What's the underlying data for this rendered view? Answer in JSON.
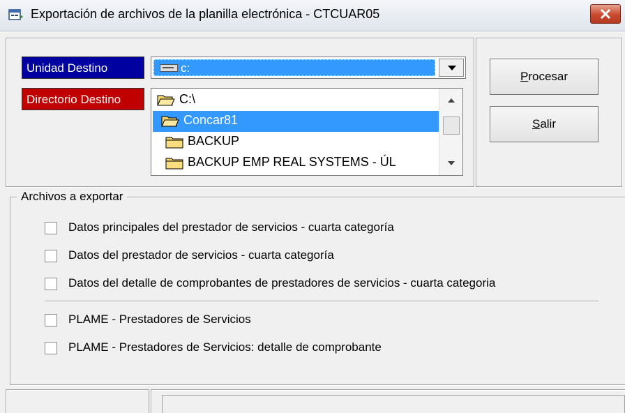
{
  "window": {
    "title": "Exportación de archivos de la planilla electrónica - CTCUAR05",
    "icons": {
      "app": "app-window-icon",
      "close": "close-icon"
    }
  },
  "destination": {
    "unit_label": "Unidad Destino",
    "unit_label_color": "#0000a0",
    "unit_value": "c:",
    "dir_label": "Directorio Destino",
    "dir_label_color": "#c00000",
    "directories": [
      {
        "name": "C:\\",
        "open": true,
        "selected": false
      },
      {
        "name": "Concar81",
        "open": true,
        "selected": true
      },
      {
        "name": "BACKUP",
        "open": false,
        "selected": false
      },
      {
        "name": "BACKUP EMP REAL SYSTEMS - ÚL",
        "open": false,
        "selected": false
      }
    ],
    "selection_color": "#3399ff"
  },
  "actions": {
    "process_label_prefix": "",
    "process_label_accel": "P",
    "process_label_rest": "rocesar",
    "exit_label_accel": "S",
    "exit_label_rest": "alir"
  },
  "files": {
    "legend": "Archivos a exportar",
    "items": [
      {
        "label": "Datos principales del prestador de servicios - cuarta categoría",
        "checked": false
      },
      {
        "label": "Datos del  prestador de servicios - cuarta categoría",
        "checked": false
      },
      {
        "label": "Datos del detalle de comprobantes de prestadores de servicios - cuarta categoria",
        "checked": false
      },
      {
        "label": "PLAME - Prestadores de Servicios",
        "checked": false
      },
      {
        "label": "PLAME - Prestadores de Servicios: detalle de comprobante",
        "checked": false
      }
    ]
  },
  "status": {
    "left": "",
    "right": ""
  }
}
